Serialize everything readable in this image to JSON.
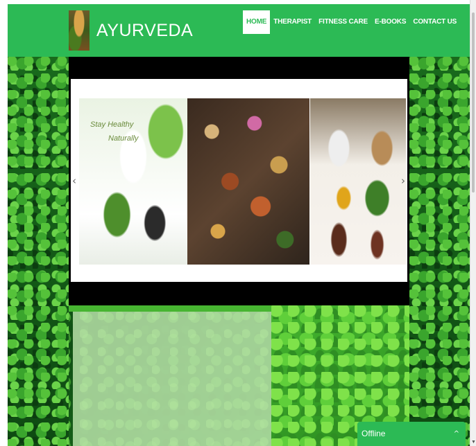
{
  "header": {
    "logo_text": "AYURVEDA",
    "nav": [
      {
        "label": "HOME",
        "active": true
      },
      {
        "label": "THERAPIST",
        "active": false
      },
      {
        "label": "FITNESS CARE",
        "active": false
      },
      {
        "label": "E-BOOKS",
        "active": false
      },
      {
        "label": "CONTACT US",
        "active": false
      }
    ]
  },
  "slider": {
    "caption_line1": "Stay Healthy",
    "caption_line2": "Naturally",
    "prev_icon": "chevron-left-icon",
    "next_icon": "chevron-right-icon",
    "prev_glyph": "‹",
    "next_glyph": "›"
  },
  "chat": {
    "status": "Offline",
    "toggle_icon": "chevron-up-icon",
    "toggle_glyph": "^"
  },
  "colors": {
    "header_bg": "#2cba55",
    "active_nav_bg": "#ffffff",
    "slider_bg": "#000000"
  }
}
